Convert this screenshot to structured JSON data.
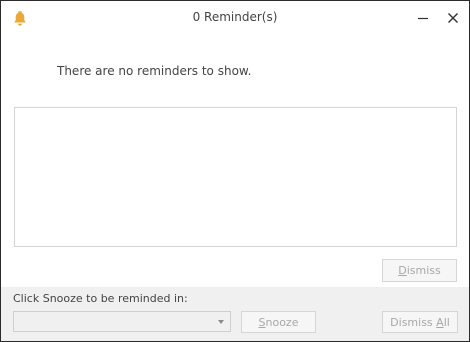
{
  "window": {
    "title": "0 Reminder(s)",
    "icon": "bell-icon",
    "accent_color": "#E9A837"
  },
  "main": {
    "empty_message": "There are no reminders to show.",
    "dismiss_button": {
      "pre": "",
      "ul": "D",
      "post": "ismiss"
    }
  },
  "footer": {
    "snooze_prompt": "Click Snooze to be reminded in:",
    "snooze_select_value": "",
    "snooze_button": {
      "pre": "",
      "ul": "S",
      "post": "nooze"
    },
    "dismiss_all_button": {
      "pre": "Dismiss ",
      "ul": "A",
      "post": "ll"
    }
  }
}
